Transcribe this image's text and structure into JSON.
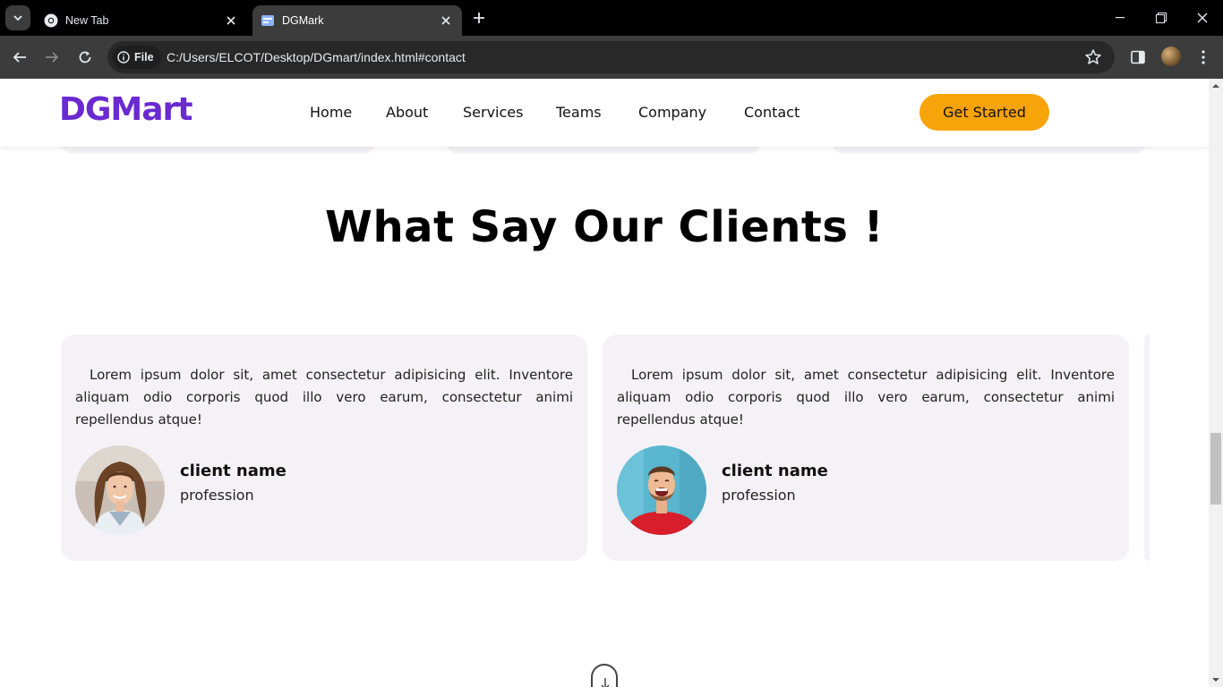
{
  "browser": {
    "tabs": [
      {
        "title": "New Tab",
        "favicon": "chrome-icon",
        "active": false
      },
      {
        "title": "DGMark",
        "favicon": "page-icon",
        "active": true
      }
    ],
    "omnibox": {
      "chip_label": "File",
      "url": "C:/Users/ELCOT/Desktop/DGmart/index.html#contact"
    }
  },
  "navbar": {
    "logo": "DGMart",
    "links": [
      "Home",
      "About",
      "Services",
      "Teams",
      "Company",
      "Contact"
    ],
    "cta_label": "Get Started",
    "brand_color": "#6a2ad0",
    "cta_color": "#f7a30a"
  },
  "testimonials": {
    "heading": "What Say Our Clients !",
    "cards": [
      {
        "text": "Lorem ipsum dolor sit, amet consectetur adipisicing elit. Inventore aliquam odio corporis quod illo vero earum, consectetur animi repellendus atque!",
        "name": "client name",
        "profession": "profession",
        "avatar": "woman-avatar"
      },
      {
        "text": "Lorem ipsum dolor sit, amet consectetur adipisicing elit. Inventore aliquam odio corporis quod illo vero earum, consectetur animi repellendus atque!",
        "name": "client name",
        "profession": "profession",
        "avatar": "man-avatar"
      }
    ],
    "card_bg": "#f4f2f7"
  }
}
